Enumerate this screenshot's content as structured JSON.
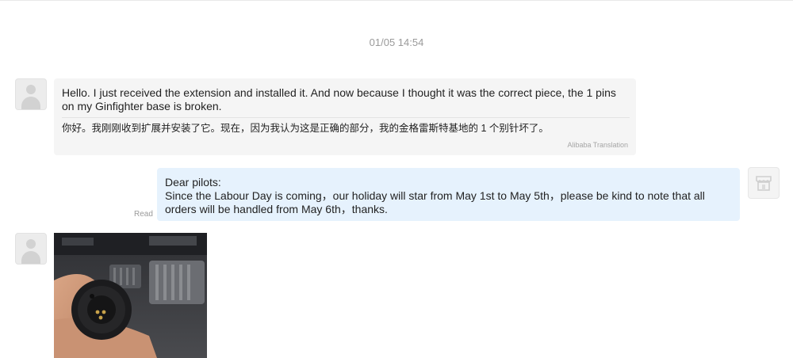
{
  "timestamp": "01/05 14:54",
  "messages": [
    {
      "direction": "incoming",
      "text_original": "Hello. I just received the extension and installed it. And now because I thought it was the correct piece, the 1 pins on my Ginfighter base is broken.",
      "text_translated": "你好。我刚刚收到扩展并安装了它。现在，因为我认为这是正确的部分，我的金格雷斯特基地的 1 个别针坏了。",
      "translation_source": "Alibaba Translation"
    },
    {
      "direction": "outgoing",
      "line1": "Dear pilots:",
      "line2": "Since the Labour Day is coming，our holiday will star from May 1st to May 5th，please be kind to note that all orders will be handled from May 6th，thanks.",
      "status": "Read"
    },
    {
      "direction": "incoming",
      "type": "image"
    }
  ],
  "icons": {
    "incoming_avatar": "user-avatar-icon",
    "shop_avatar": "shop-store-icon"
  },
  "colors": {
    "incoming_bubble": "#f5f5f5",
    "outgoing_bubble": "#e6f2fd",
    "muted_text": "#9a9a9a"
  }
}
